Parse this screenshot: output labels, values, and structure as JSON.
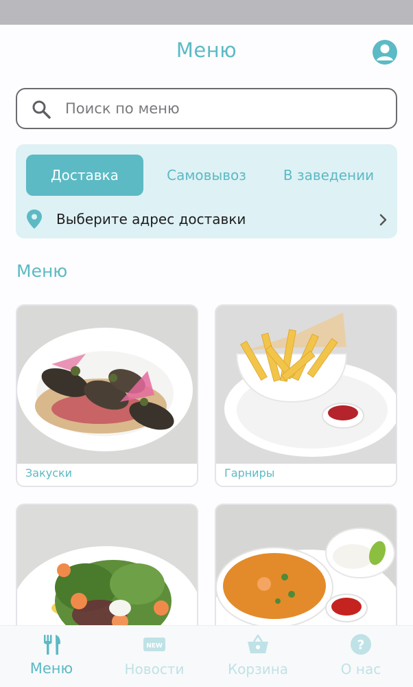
{
  "header": {
    "title": "Меню"
  },
  "search": {
    "placeholder": "Поиск по меню"
  },
  "order_mode": {
    "tabs": [
      {
        "label": "Доставка",
        "active": true
      },
      {
        "label": "Самовывоз",
        "active": false
      },
      {
        "label": "В заведении",
        "active": false
      }
    ],
    "address_prompt": "Выберите адрес доставки"
  },
  "menu": {
    "section_title": "Меню",
    "categories": [
      {
        "label": "Закуски",
        "image": "eggplant-rolls-photo"
      },
      {
        "label": "Гарниры",
        "image": "french-fries-photo"
      },
      {
        "label": "",
        "image": "shrimp-salad-photo"
      },
      {
        "label": "",
        "image": "shrimp-curry-soup-photo"
      }
    ]
  },
  "bottom_nav": {
    "items": [
      {
        "label": "Меню",
        "icon": "fork-knife-icon",
        "active": true
      },
      {
        "label": "Новости",
        "icon": "news-icon",
        "active": false
      },
      {
        "label": "Корзина",
        "icon": "basket-icon",
        "active": false
      },
      {
        "label": "О нас",
        "icon": "help-icon",
        "active": false
      }
    ]
  },
  "colors": {
    "accent": "#5bbac4",
    "accent_light": "#def1f4",
    "inactive_nav": "#bfe2e7"
  }
}
